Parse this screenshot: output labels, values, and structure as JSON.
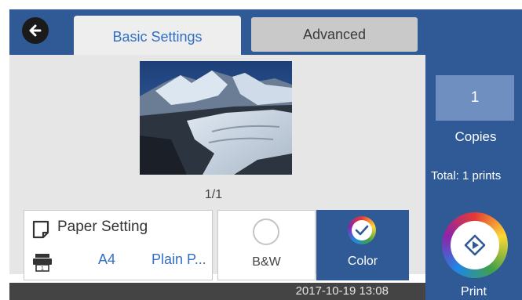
{
  "tabs": {
    "basic": "Basic Settings",
    "advanced": "Advanced"
  },
  "preview": {
    "page_indicator": "1/1"
  },
  "paper": {
    "title": "Paper Setting",
    "size": "A4",
    "type": "Plain P..."
  },
  "color_mode": {
    "bw_label": "B&W",
    "color_label": "Color",
    "selected": "Color"
  },
  "copies": {
    "count": "1",
    "label": "Copies",
    "total": "Total: 1 prints"
  },
  "print": {
    "label": "Print"
  },
  "status": {
    "datetime": "2017-10-19 13:08"
  },
  "icons": [
    "back-arrow-icon",
    "paper-icon",
    "printer-tray-icon",
    "checkmark-icon",
    "print-start-icon"
  ],
  "colors": {
    "accent": "#2f5a96",
    "tab_active_text": "#2f6fc4",
    "copies_box": "#6f8fc0"
  }
}
